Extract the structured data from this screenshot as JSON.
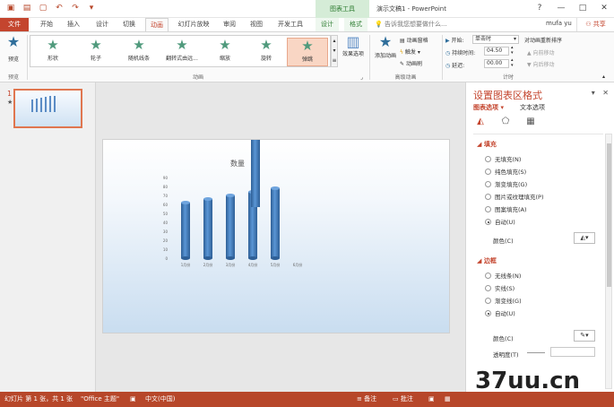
{
  "app": {
    "doc_title": "演示文稿1 - PowerPoint",
    "context_group": "图表工具",
    "window_controls": [
      "?",
      "—",
      "□",
      "✕"
    ],
    "search_tip": "告诉我您想要做什么...",
    "user": "mufa yu",
    "share": "共享"
  },
  "tabs": [
    "文件",
    "开始",
    "插入",
    "设计",
    "切换",
    "动画",
    "幻灯片放映",
    "审阅",
    "视图",
    "开发工具",
    "设计",
    "格式"
  ],
  "ribbon": {
    "preview": {
      "label": "预览",
      "group": "预览"
    },
    "animations": [
      {
        "label": "形状",
        "icon": "star-shape-icon"
      },
      {
        "label": "轮子",
        "icon": "star-wheel-icon"
      },
      {
        "label": "随机线条",
        "icon": "star-random-bars-icon"
      },
      {
        "label": "翻转式由远...",
        "icon": "star-grow-turn-icon"
      },
      {
        "label": "缩放",
        "icon": "star-zoom-icon"
      },
      {
        "label": "旋转",
        "icon": "star-swivel-icon"
      },
      {
        "label": "弹跳",
        "icon": "star-bounce-icon"
      }
    ],
    "effect_options": "效果选项",
    "animation_group": "动画",
    "add_animation": "添加动画",
    "advanced": {
      "pane": "动画窗格",
      "trigger": "触发",
      "painter": "动画刷",
      "group": "高级动画"
    },
    "timing": {
      "start_label": "开始:",
      "start_value": "单击时",
      "duration_label": "持续时间:",
      "duration_value": "04.50",
      "delay_label": "延迟:",
      "delay_value": "00.00",
      "reorder": "对动画重新排序",
      "earlier": "向前移动",
      "later": "向后移动",
      "group": "计时"
    }
  },
  "slides_pane": {
    "number": "1",
    "star": "★"
  },
  "chart_data": {
    "type": "bar",
    "title": "数量",
    "categories": [
      "1月份",
      "2月份",
      "3月份",
      "4月份",
      "5月份",
      "6月份"
    ],
    "values": [
      62,
      66,
      70,
      74,
      78,
      0
    ],
    "ylim": [
      0,
      90
    ],
    "yticks": [
      0,
      10,
      20,
      30,
      40,
      50,
      60,
      70,
      80,
      90
    ],
    "xlabel": "",
    "ylabel": "",
    "grid": false,
    "style": "3D cylinder",
    "bar_color": "#3f7fc4",
    "bouncing_bar_category": "4月份"
  },
  "format_pane": {
    "title": "设置图表区格式",
    "tab_chart": "图表选项",
    "tab_text": "文本选项",
    "fill_section": "填充",
    "fill_options": [
      "无填充(N)",
      "纯色填充(S)",
      "渐变填充(G)",
      "图片或纹理填充(P)",
      "图案填充(A)",
      "自动(U)"
    ],
    "fill_selected": "自动(U)",
    "color_label": "颜色(C)",
    "border_section": "边框",
    "border_options": [
      "无线条(N)",
      "实线(S)",
      "渐变线(G)",
      "自动(U)"
    ],
    "border_selected": "自动(U)",
    "border_color_label": "颜色(C)",
    "transparency_label": "透明度(T)"
  },
  "status": {
    "slide_info": "幻灯片 第 1 张，共 1 张",
    "theme": "\"Office 主题\"",
    "language": "中文(中国)",
    "notes": "备注",
    "comments": "批注"
  },
  "watermark": "37uu.cn",
  "colors": {
    "accent": "#c4452e",
    "context": "#2e7d32"
  }
}
